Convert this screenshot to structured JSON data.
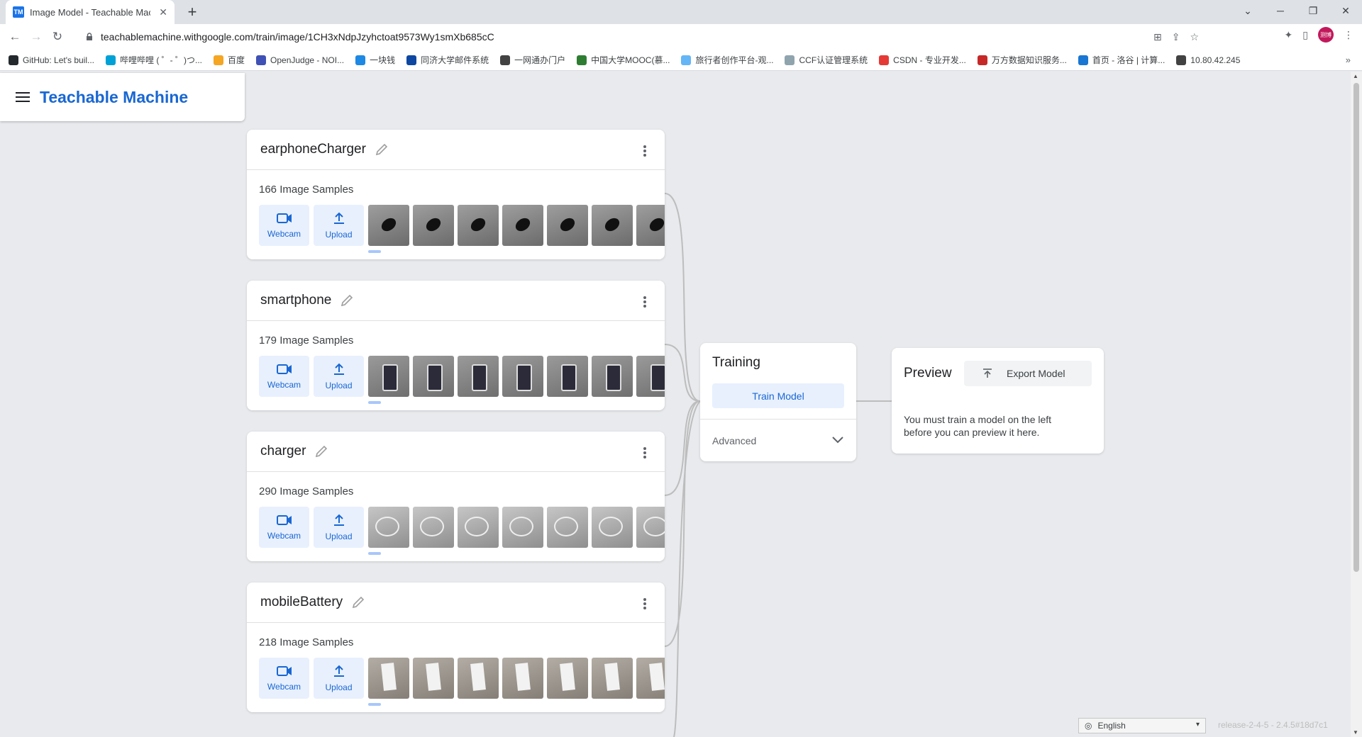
{
  "browser": {
    "tab_title": "Image Model - Teachable Mac",
    "favicon_text": "TM",
    "url": "teachablemachine.withgoogle.com/train/image/1CH3xNdpJzyhctoat9573Wy1smXb685cC",
    "profile_badge": "测博",
    "bookmarks": [
      {
        "label": "GitHub: Let's buil...",
        "color": "#24292e"
      },
      {
        "label": "哔哩哔哩 ( ゜- ゜)つ...",
        "color": "#00a1d6"
      },
      {
        "label": "百度",
        "color": "#f5a623"
      },
      {
        "label": "OpenJudge - NOI...",
        "color": "#3f51b5"
      },
      {
        "label": "一块钱",
        "color": "#1e88e5"
      },
      {
        "label": "同济大学邮件系统",
        "color": "#0d47a1"
      },
      {
        "label": "一网通办门户",
        "color": "#424242"
      },
      {
        "label": "中国大学MOOC(慕...",
        "color": "#2e7d32"
      },
      {
        "label": "旅行者创作平台-观...",
        "color": "#64b5f6"
      },
      {
        "label": "CCF认证管理系统",
        "color": "#90a4ae"
      },
      {
        "label": "CSDN - 专业开发...",
        "color": "#e53935"
      },
      {
        "label": "万方数据知识服务...",
        "color": "#c62828"
      },
      {
        "label": "首页 - 洛谷 | 计算...",
        "color": "#1976d2"
      },
      {
        "label": "10.80.42.245",
        "color": "#424242"
      }
    ],
    "bookmarks_more": "»"
  },
  "app": {
    "brand": "Teachable Machine",
    "classes": [
      {
        "name": "earphoneCharger",
        "samples": "166 Image Samples",
        "thumb_style": "black"
      },
      {
        "name": "smartphone",
        "samples": "179 Image Samples",
        "thumb_style": "phone"
      },
      {
        "name": "charger",
        "samples": "290 Image Samples",
        "thumb_style": "charger"
      },
      {
        "name": "mobileBattery",
        "samples": "218 Image Samples",
        "thumb_style": "battery"
      }
    ],
    "webcam_label": "Webcam",
    "upload_label": "Upload",
    "training": {
      "title": "Training",
      "train_button": "Train Model",
      "advanced_label": "Advanced"
    },
    "preview": {
      "title": "Preview",
      "export_button": "Export Model",
      "message": "You must train a model on the left before you can preview it here."
    },
    "footer": {
      "language": "English",
      "release": "release-2-4-5 - 2.4.5#18d7c1"
    }
  },
  "colors": {
    "accent": "#1967d2",
    "button_bg": "#e8f0fe",
    "page_bg": "#e8eaed"
  }
}
